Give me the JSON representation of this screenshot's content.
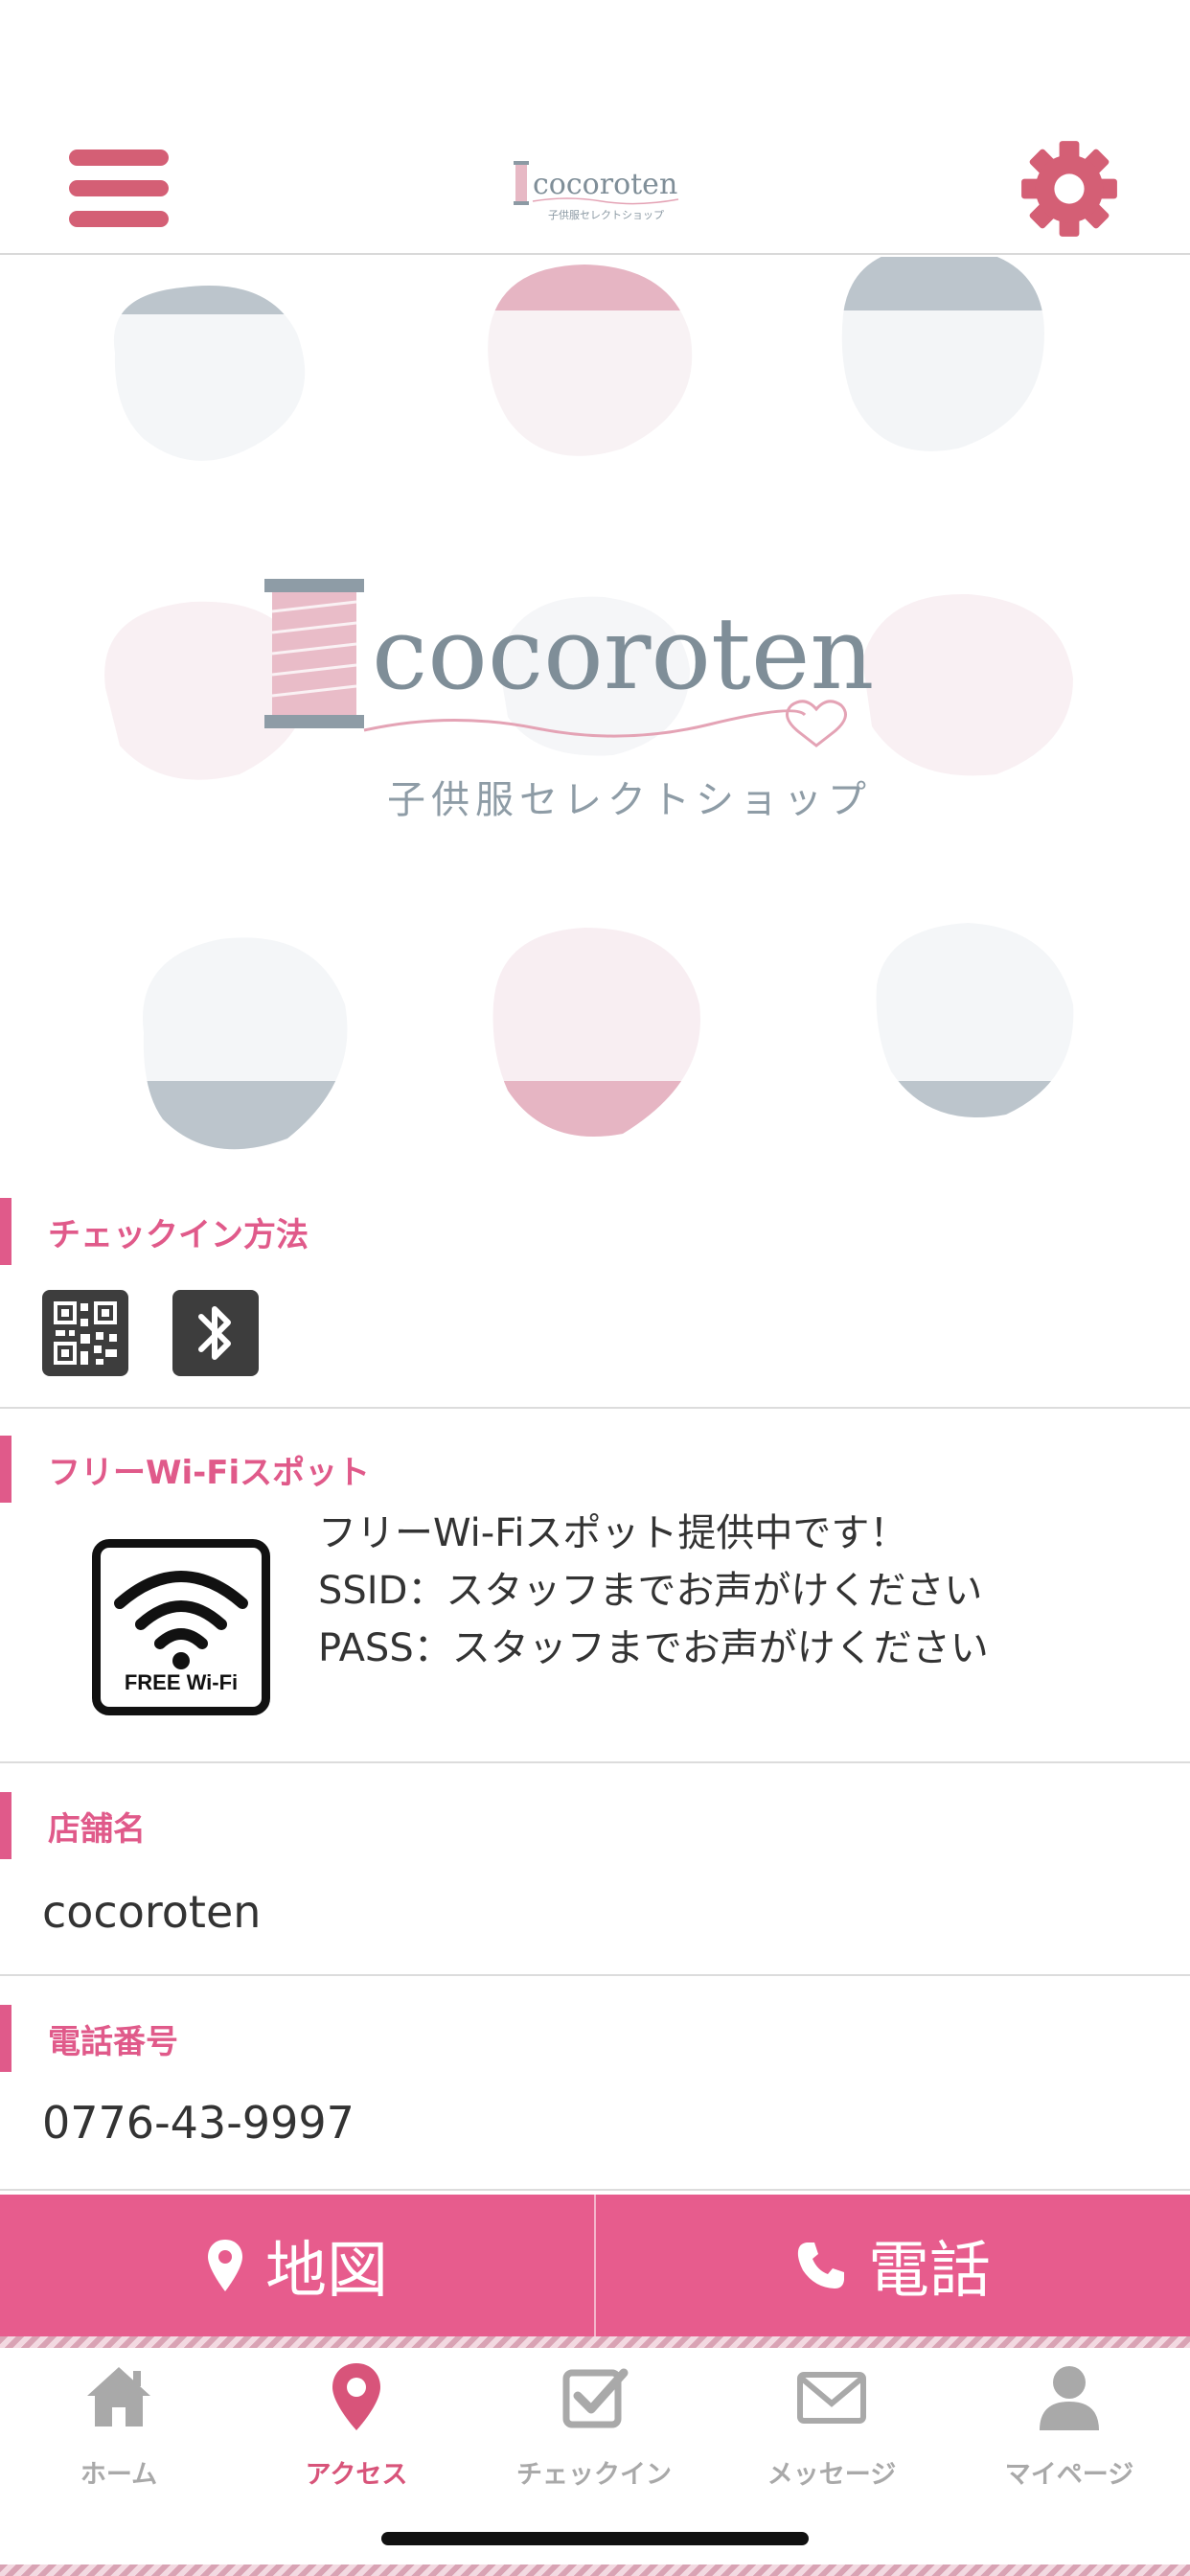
{
  "header": {
    "logo_text": "cocoroten",
    "logo_subtitle": "子供服セレクトショップ"
  },
  "hero": {
    "logo_text": "cocoroten",
    "logo_subtitle": "子供服セレクトショップ"
  },
  "checkin": {
    "title": "チェックイン方法",
    "methods": [
      "qr-code",
      "bluetooth"
    ]
  },
  "wifi": {
    "title": "フリーWi-Fiスポット",
    "badge_label": "FREE Wi-Fi",
    "lines": [
      "フリーWi-Fiスポット提供中です！",
      "SSID：スタッフまでお声がけください",
      "PASS：スタッフまでお声がけください"
    ]
  },
  "store": {
    "title": "店舗名",
    "value": "cocoroten"
  },
  "phone": {
    "title": "電話番号",
    "value": "0776-43-9997"
  },
  "actions": {
    "map_label": "地図",
    "call_label": "電話"
  },
  "tabbar": {
    "items": [
      {
        "label": "ホーム",
        "icon": "home-icon",
        "active": false
      },
      {
        "label": "アクセス",
        "icon": "map-pin-icon",
        "active": true
      },
      {
        "label": "チェックイン",
        "icon": "checkin-icon",
        "active": false
      },
      {
        "label": "メッセージ",
        "icon": "mail-icon",
        "active": false
      },
      {
        "label": "マイページ",
        "icon": "user-icon",
        "active": false
      }
    ]
  },
  "colors": {
    "accent": "#e05a8a",
    "menu": "#d45f75",
    "action_bar": "#e75c8d",
    "tab_inactive": "#a9a9a9"
  }
}
